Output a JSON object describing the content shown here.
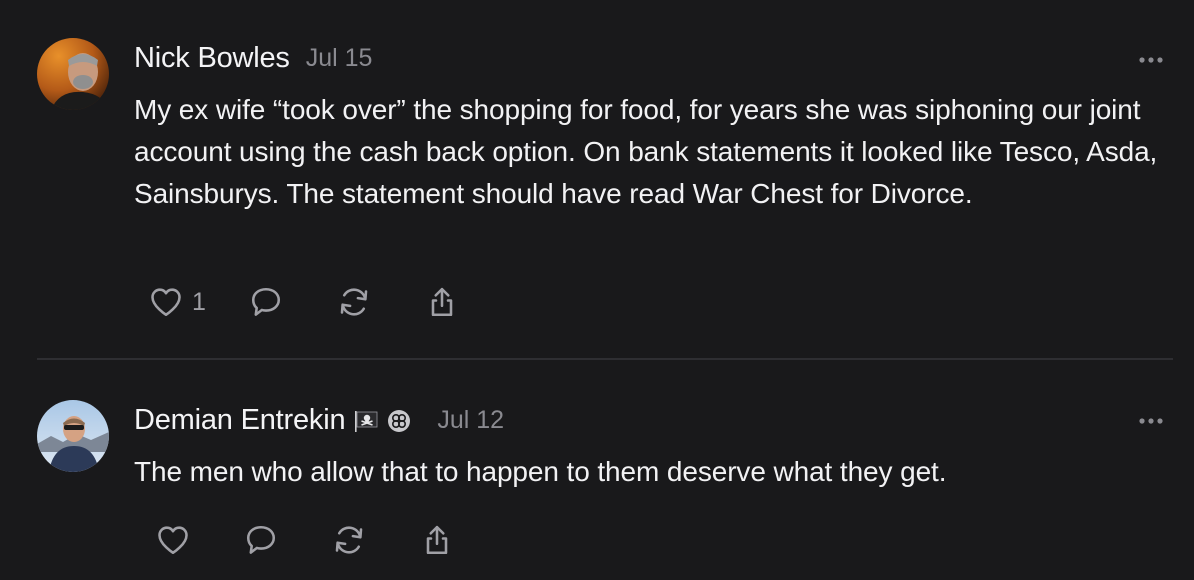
{
  "comments": [
    {
      "author": "Nick Bowles",
      "date": "Jul 15",
      "text": "My ex wife “took over” the shopping for food, for years she was siphoning our joint account using the cash back option. On bank statements it looked like Tesco, Asda, Sainsburys. The statement should have read War Chest for Divorce.",
      "like_count": "1",
      "icons": [
        "heart-icon",
        "comment-icon",
        "repost-icon",
        "share-icon",
        "more-icon"
      ]
    },
    {
      "author": "Demian Entrekin",
      "date": "Jul 12",
      "text": "The men who allow that to happen to them deserve what they get.",
      "badges": [
        "pirate-flag-icon",
        "badge-icon"
      ],
      "icons": [
        "heart-icon",
        "comment-icon",
        "repost-icon",
        "share-icon",
        "more-icon"
      ]
    }
  ],
  "colors": {
    "background": "#19191b",
    "text": "#f2f2f4",
    "muted": "#8a8a90",
    "icon": "#a0a0a6",
    "divider": "#2e2e32"
  }
}
